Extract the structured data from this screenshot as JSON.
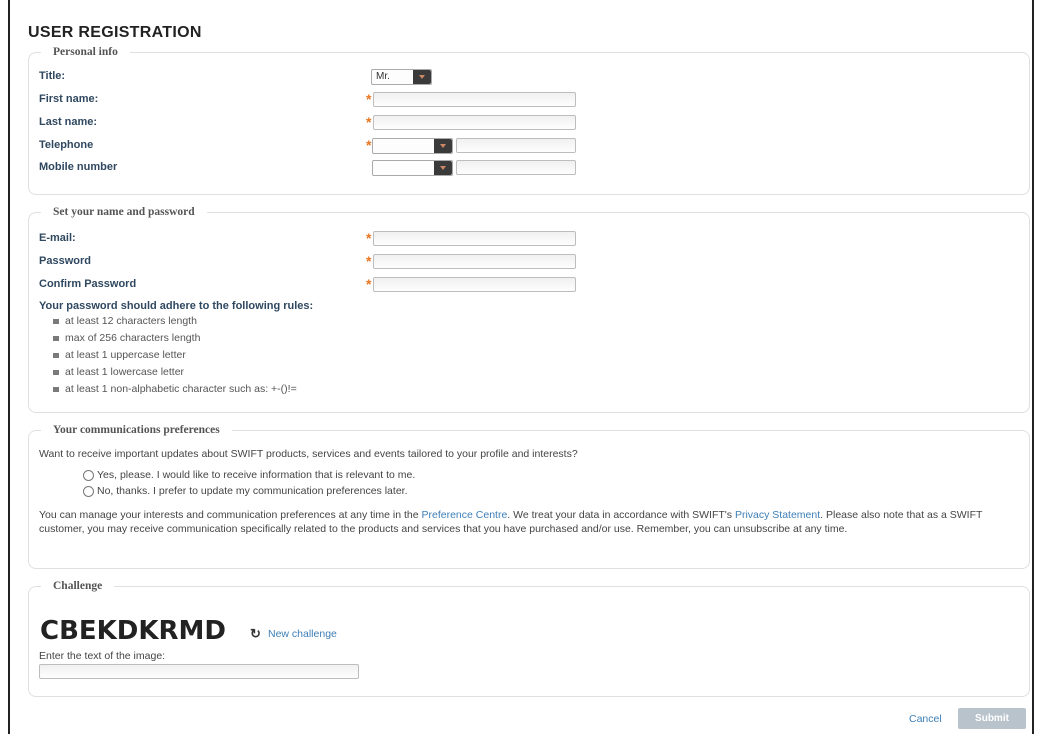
{
  "page_title": "USER REGISTRATION",
  "required_mark": "*",
  "personal": {
    "legend": "Personal info",
    "title_label": "Title:",
    "title_value": "Mr.",
    "first_name_label": "First name:",
    "last_name_label": "Last name:",
    "telephone_label": "Telephone",
    "mobile_label": "Mobile number"
  },
  "account": {
    "legend": "Set your name and password",
    "email_label": "E-mail:",
    "password_label": "Password",
    "confirm_label": "Confirm Password",
    "rules_title": "Your password should adhere to the following rules:",
    "rules": [
      "at least 12 characters length",
      "max of 256 characters length",
      "at least 1 uppercase letter",
      "at least 1 lowercase letter",
      "at least 1 non-alphabetic character such as: +-()!="
    ]
  },
  "communications": {
    "legend": "Your communications preferences",
    "question": "Want to receive important updates about SWIFT products, services and events tailored to your profile and interests?",
    "option_yes": "Yes, please. I would like to receive information that is relevant to me.",
    "option_no": "No, thanks. I prefer to update my communication preferences later.",
    "para_part1": "You can manage your interests and communication preferences at any time in the ",
    "preference_link": "Preference Centre",
    "para_part2": ". We treat your data in accordance with SWIFT's ",
    "privacy_link": "Privacy Statement",
    "para_part3": ". Please also note that as a SWIFT customer, you may receive communication specifically related to the products and services that you have purchased and/or use. Remember, you can unsubscribe at any time."
  },
  "challenge": {
    "legend": "Challenge",
    "captcha_text": "CBEKDKRMD",
    "new_challenge": "New challenge",
    "prompt": "Enter the text of the image:"
  },
  "footer": {
    "cancel": "Cancel",
    "submit": "Submit"
  },
  "colors": {
    "label": "#2f4860",
    "required": "#e87722",
    "link": "#3d7fb7",
    "submit_bg": "#b9c3cc"
  },
  "icons": {
    "refresh": "refresh-icon",
    "dropdown": "chevron-down-icon"
  }
}
